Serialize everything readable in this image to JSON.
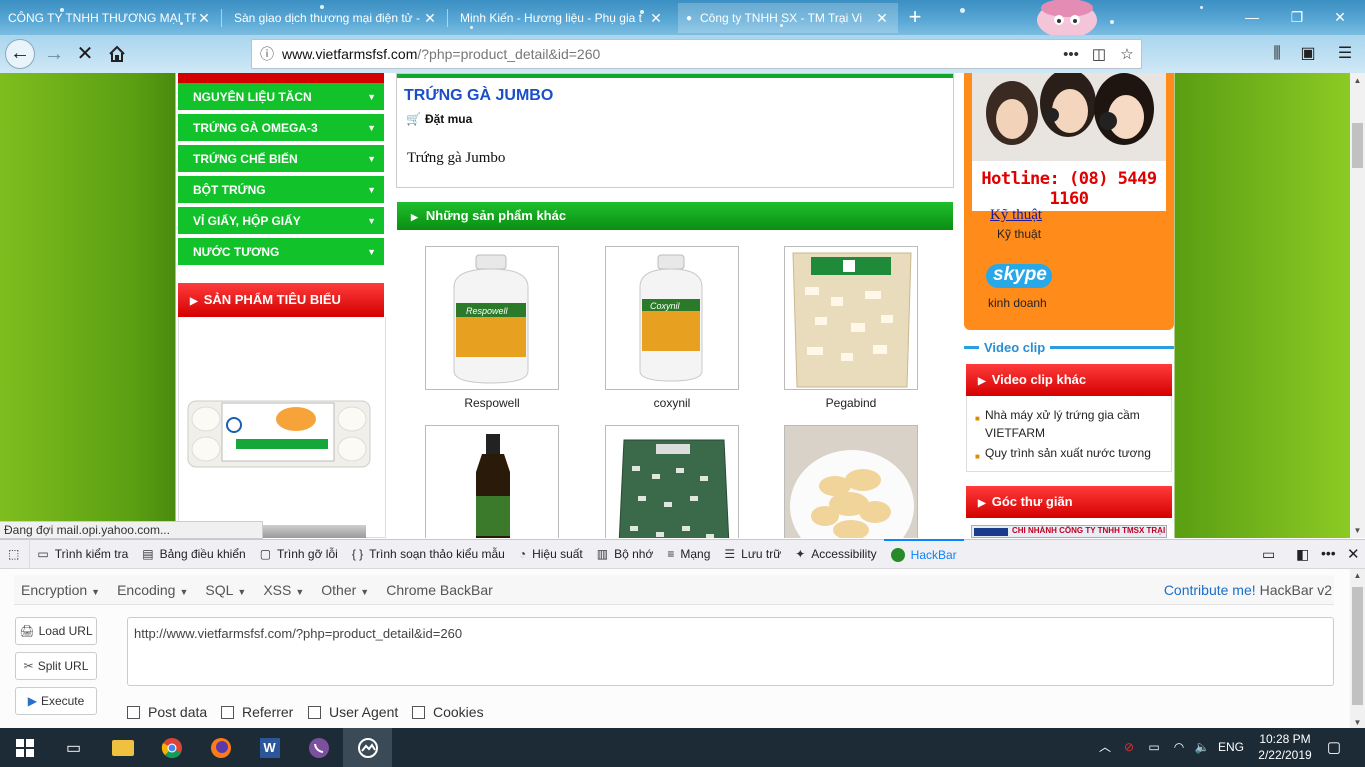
{
  "browser": {
    "tabs": [
      {
        "title": "CÔNG TY TNHH THƯƠNG MẠI TR",
        "active": false
      },
      {
        "title": "Sàn giao dịch thương mại điện tử -",
        "active": false
      },
      {
        "title": "Minh Kiến - Hương liệu - Phụ gia t",
        "active": false
      },
      {
        "title": "Công ty TNHH SX - TM Trại Vi",
        "active": true,
        "loading": true
      }
    ],
    "new_tab": "+",
    "url_domain": "www.vietfarmsfsf.com",
    "url_path": "/?php=product_detail&id=260",
    "status": "Đang đợi mail.opi.yahoo.com..."
  },
  "page": {
    "left_menu": [
      "NGUYÊN LIỆU TĂCN",
      "TRỨNG GÀ OMEGA-3",
      "TRỨNG CHẾ BIẾN",
      "BỘT TRỨNG",
      "VỈ GIẤY, HỘP GIẤY",
      "NƯỚC TƯƠNG"
    ],
    "featured_header": "SẢN PHẨM TIÊU BIỂU",
    "product_title": "TRỨNG GÀ JUMBO",
    "order_label": "Đặt mua",
    "product_desc": "Trứng gà Jumbo",
    "other_products_header": "Những sản phẩm khác",
    "products": [
      {
        "name": "Respowell"
      },
      {
        "name": "coxynil"
      },
      {
        "name": "Pegabind"
      },
      {
        "name": ""
      },
      {
        "name": ""
      },
      {
        "name": ""
      }
    ],
    "hotline": "Hotline: (08) 5449 1160",
    "support": {
      "tech_link": "Kỹ thuật",
      "tech_sub": "Kỹ thuật",
      "skype_logo": "skype",
      "sales_label": "kinh doanh"
    },
    "video_label": "Video clip",
    "video_header": "Video clip khác",
    "videos": [
      "Nhà máy xử lý trứng gia cầm VIETFARM",
      "Quy trình sản xuất nước tương"
    ],
    "relax_header": "Góc thư giãn",
    "relax_banner": "CHI NHÁNH CÔNG TY TNHH TMSX TRẠI VIỆT"
  },
  "devtools": {
    "tabs": [
      {
        "label": "Trình kiểm tra",
        "icon": "inspector-icon"
      },
      {
        "label": "Bảng điều khiển",
        "icon": "console-icon"
      },
      {
        "label": "Trình gỡ lỗi",
        "icon": "debugger-icon"
      },
      {
        "label": "Trình soạn thảo kiểu mẫu",
        "icon": "style-editor-icon"
      },
      {
        "label": "Hiệu suất",
        "icon": "performance-icon"
      },
      {
        "label": "Bộ nhớ",
        "icon": "memory-icon"
      },
      {
        "label": "Mạng",
        "icon": "network-icon"
      },
      {
        "label": "Lưu trữ",
        "icon": "storage-icon"
      },
      {
        "label": "Accessibility",
        "icon": "accessibility-icon"
      },
      {
        "label": "HackBar",
        "icon": "hackbar-icon",
        "active": true
      }
    ]
  },
  "hackbar": {
    "menus": [
      "Encryption",
      "Encoding",
      "SQL",
      "XSS",
      "Other"
    ],
    "chrome_backbar": "Chrome BackBar",
    "contribute": "Contribute me!",
    "version": "HackBar v2",
    "load_url": "Load URL",
    "split_url": "Split URL",
    "execute": "Execute",
    "url_value": "http://www.vietfarmsfsf.com/?php=product_detail&id=260",
    "options": [
      "Post data",
      "Referrer",
      "User Agent",
      "Cookies"
    ]
  },
  "taskbar": {
    "language": "ENG",
    "time": "10:28 PM",
    "date": "2/22/2019"
  },
  "colors": {
    "menu_green": "#12c22a",
    "header_red": "#e00000",
    "title_blue": "#1a4fc8",
    "hotline_red": "#e00000",
    "orange_panel": "#ff8c1a",
    "devtools_active": "#0a84ff"
  }
}
